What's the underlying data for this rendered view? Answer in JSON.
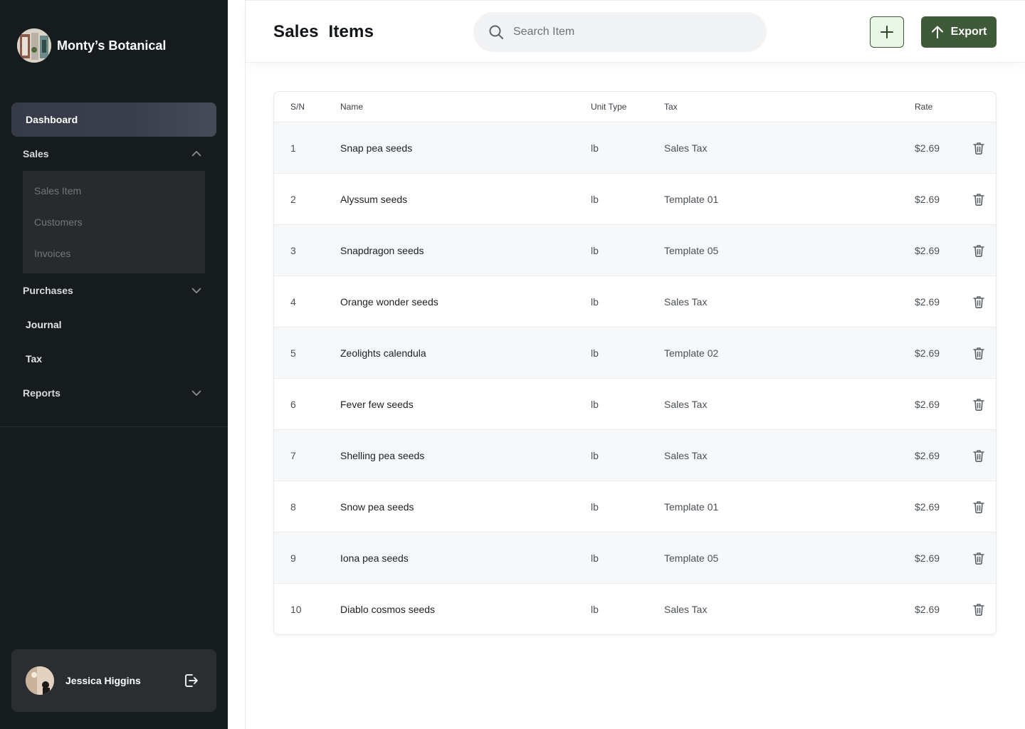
{
  "brand": {
    "name": "Monty’s Botanical"
  },
  "sidebar": {
    "dashboard_label": "Dashboard",
    "sales": {
      "label": "Sales",
      "items": [
        "Sales Item",
        "Customers",
        "Invoices"
      ]
    },
    "purchases_label": "Purchases",
    "journal_label": "Journal",
    "tax_label": "Tax",
    "reports_label": "Reports"
  },
  "user": {
    "name": "Jessica Higgins"
  },
  "header": {
    "title": "Sales  Items",
    "search_placeholder": "Search Item",
    "export_label": "Export"
  },
  "table": {
    "columns": {
      "sn": "S/N",
      "name": "Name",
      "unit": "Unit Type",
      "tax": "Tax",
      "rate": "Rate"
    },
    "rows": [
      {
        "sn": "1",
        "name": "Snap pea seeds",
        "unit": "lb",
        "tax": "Sales Tax",
        "rate": "$2.69"
      },
      {
        "sn": "2",
        "name": "Alyssum seeds",
        "unit": "lb",
        "tax": "Template 01",
        "rate": "$2.69"
      },
      {
        "sn": "3",
        "name": "Snapdragon seeds",
        "unit": "lb",
        "tax": "Template 05",
        "rate": "$2.69"
      },
      {
        "sn": "4",
        "name": "Orange wonder seeds",
        "unit": "lb",
        "tax": "Sales Tax",
        "rate": "$2.69"
      },
      {
        "sn": "5",
        "name": "Zeolights calendula",
        "unit": "lb",
        "tax": "Template 02",
        "rate": "$2.69"
      },
      {
        "sn": "6",
        "name": "Fever few seeds",
        "unit": "lb",
        "tax": "Sales Tax",
        "rate": "$2.69"
      },
      {
        "sn": "7",
        "name": "Shelling pea seeds",
        "unit": "lb",
        "tax": "Sales Tax",
        "rate": "$2.69"
      },
      {
        "sn": "8",
        "name": "Snow pea seeds",
        "unit": "lb",
        "tax": "Template 01",
        "rate": "$2.69"
      },
      {
        "sn": "9",
        "name": "Iona pea seeds",
        "unit": "lb",
        "tax": "Template 05",
        "rate": "$2.69"
      },
      {
        "sn": "10",
        "name": "Diablo cosmos seeds",
        "unit": "lb",
        "tax": "Sales Tax",
        "rate": "$2.69"
      }
    ]
  },
  "colors": {
    "sidebar_bg": "#161b1e",
    "accent": "#3e5a38",
    "accent_light": "#eaf7e6"
  },
  "icons": [
    "search-icon",
    "plus-icon",
    "arrow-up-icon",
    "chevron-up-icon",
    "chevron-down-icon",
    "trash-icon",
    "logout-icon"
  ]
}
